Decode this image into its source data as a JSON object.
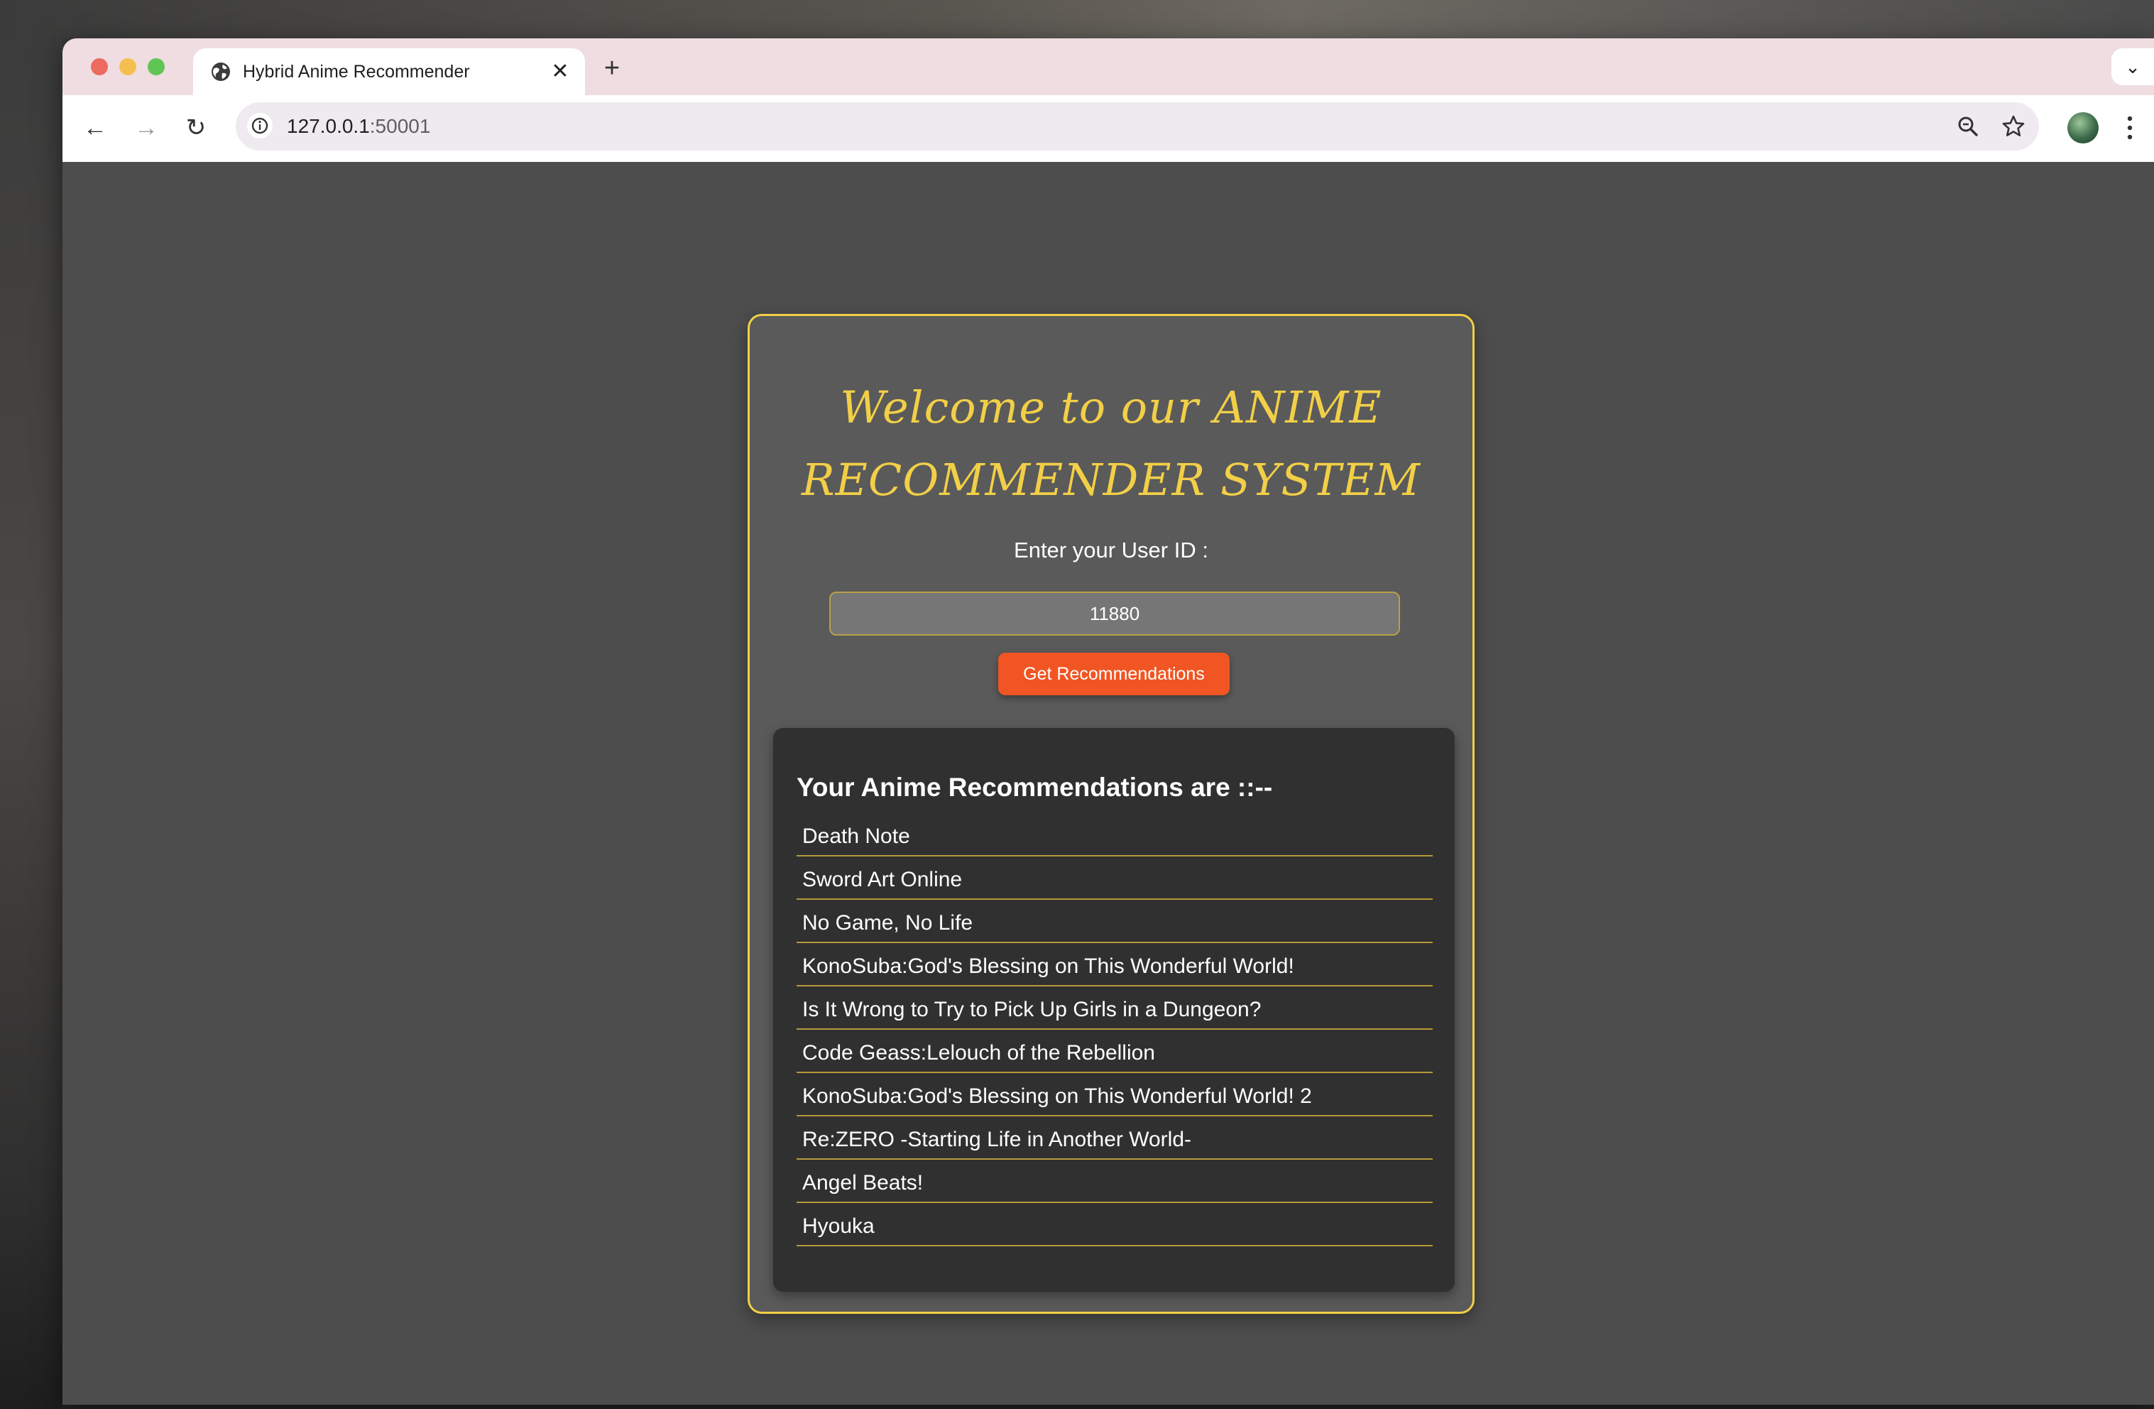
{
  "browser": {
    "tab_title": "Hybrid Anime Recommender",
    "tab_close": "✕",
    "new_tab": "+",
    "tab_menu": "⌄",
    "url_host": "127.0.0.1",
    "url_port": ":50001",
    "nav": {
      "back": "←",
      "forward": "→",
      "reload": "↻"
    },
    "icons": [
      "globe-icon",
      "info-icon",
      "zoom-icon",
      "star-icon",
      "avatar",
      "kebab-menu-icon"
    ]
  },
  "page": {
    "title": "Welcome to our ANIME RECOMMENDER SYSTEM",
    "user_id_label": "Enter your User ID :",
    "user_id_value": "11880",
    "submit_label": "Get Recommendations",
    "results_heading": "Your Anime Recommendations are ::--",
    "recommendations": [
      "Death Note",
      "Sword Art Online",
      "No Game, No Life",
      "KonoSuba:God's Blessing on This Wonderful World!",
      "Is It Wrong to Try to Pick Up Girls in a Dungeon?",
      "Code Geass:Lelouch of the Rebellion",
      "KonoSuba:God's Blessing on This Wonderful World! 2",
      "Re:ZERO -Starting Life in Another World-",
      "Angel Beats!",
      "Hyouka"
    ]
  },
  "colors": {
    "accent": "#f2cf47",
    "button": "#f05523",
    "card_bg": "#5a5a5a",
    "results_bg": "#303030",
    "page_bg": "#4d4d4d"
  }
}
